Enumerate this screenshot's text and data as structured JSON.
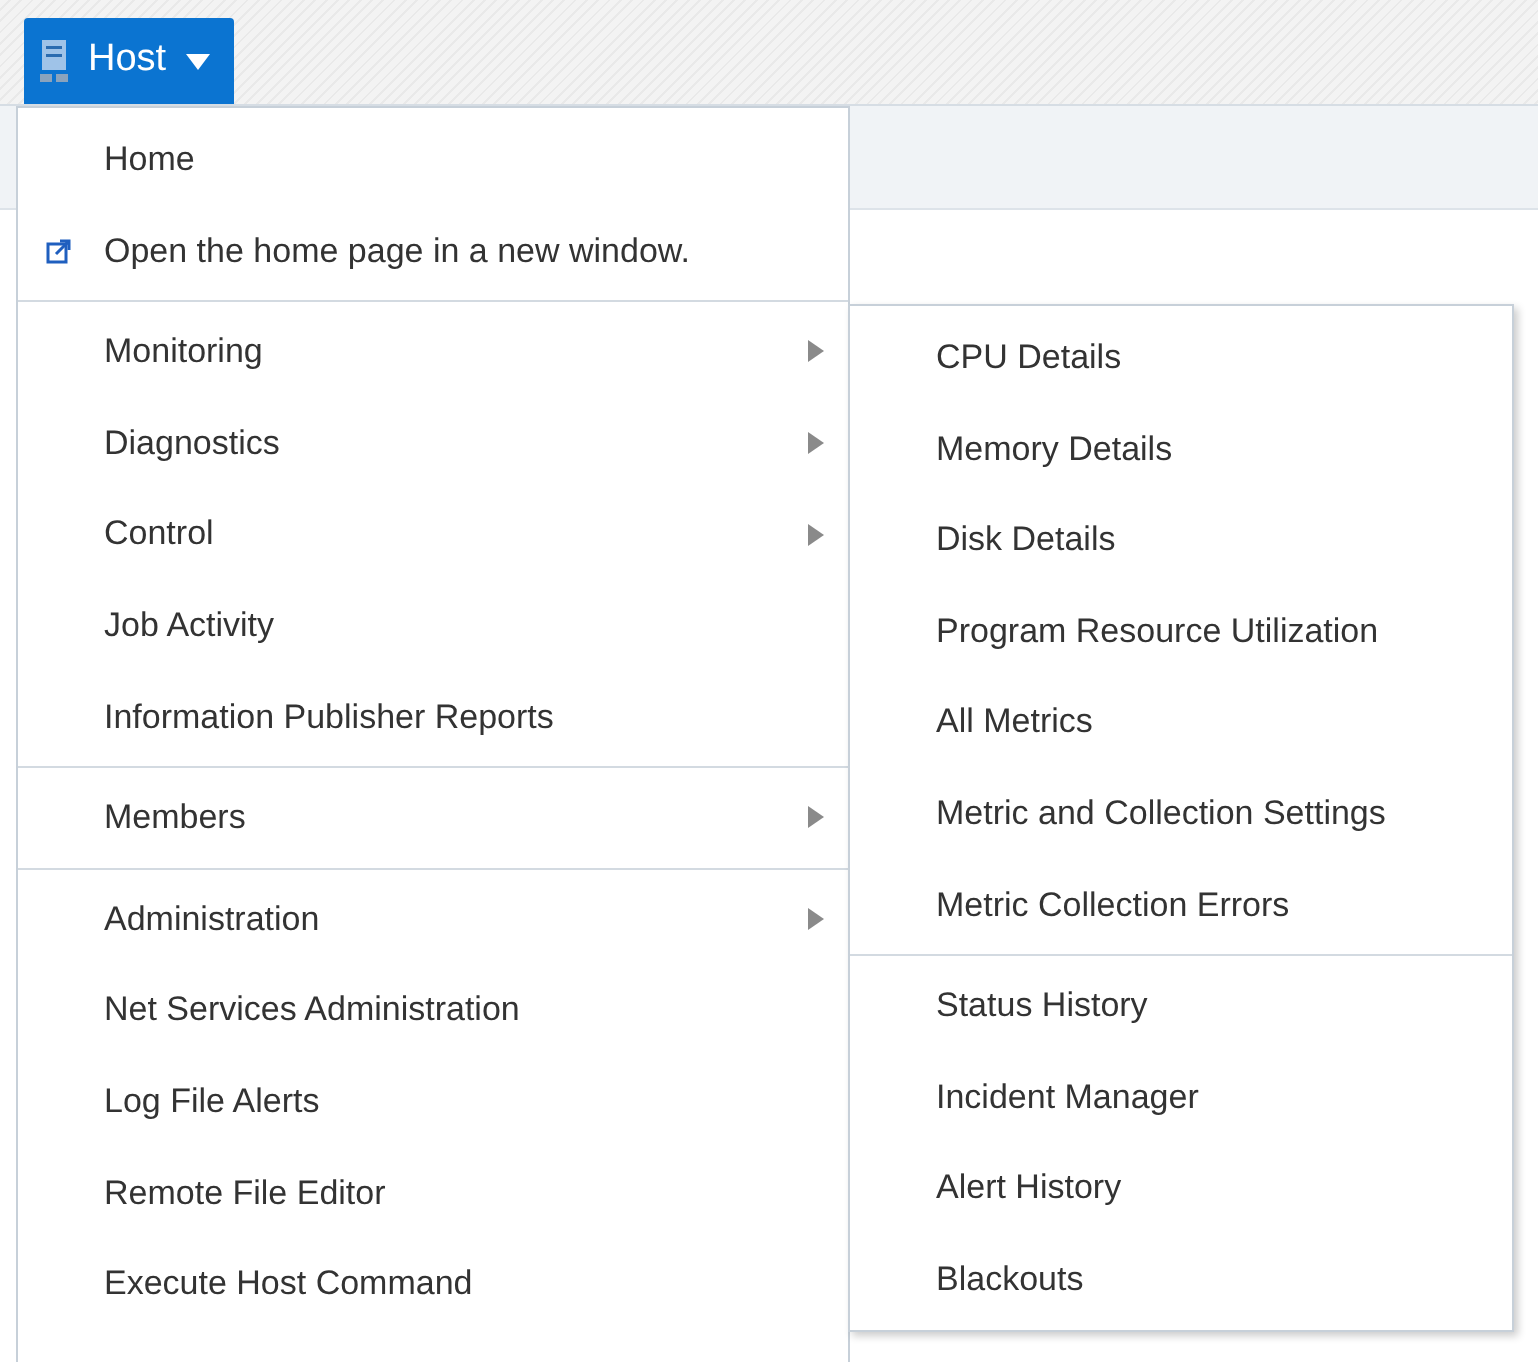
{
  "host_button": {
    "label": "Host"
  },
  "menu": {
    "groups": [
      {
        "items": [
          {
            "label": "Home",
            "kind": "plain",
            "has_submenu": false
          },
          {
            "label": "Open the home page in a new window.",
            "kind": "external",
            "has_submenu": false
          }
        ]
      },
      {
        "items": [
          {
            "label": "Monitoring",
            "kind": "plain",
            "has_submenu": true
          },
          {
            "label": "Diagnostics",
            "kind": "plain",
            "has_submenu": true
          },
          {
            "label": "Control",
            "kind": "plain",
            "has_submenu": true
          },
          {
            "label": "Job Activity",
            "kind": "plain",
            "has_submenu": false
          },
          {
            "label": "Information Publisher Reports",
            "kind": "plain",
            "has_submenu": false
          }
        ]
      },
      {
        "items": [
          {
            "label": "Members",
            "kind": "plain",
            "has_submenu": true
          }
        ]
      },
      {
        "items": [
          {
            "label": "Administration",
            "kind": "plain",
            "has_submenu": true
          },
          {
            "label": "Net Services Administration",
            "kind": "plain",
            "has_submenu": false
          },
          {
            "label": "Log File Alerts",
            "kind": "plain",
            "has_submenu": false
          },
          {
            "label": "Remote File Editor",
            "kind": "plain",
            "has_submenu": false
          },
          {
            "label": "Execute Host Command",
            "kind": "plain",
            "has_submenu": false
          }
        ]
      }
    ]
  },
  "submenu": {
    "groups": [
      {
        "items": [
          "CPU Details",
          "Memory Details",
          "Disk Details",
          "Program Resource Utilization",
          "All Metrics",
          "Metric and Collection Settings",
          "Metric Collection Errors"
        ]
      },
      {
        "items": [
          "Status History",
          "Incident Manager",
          "Alert History",
          "Blackouts"
        ]
      }
    ]
  }
}
